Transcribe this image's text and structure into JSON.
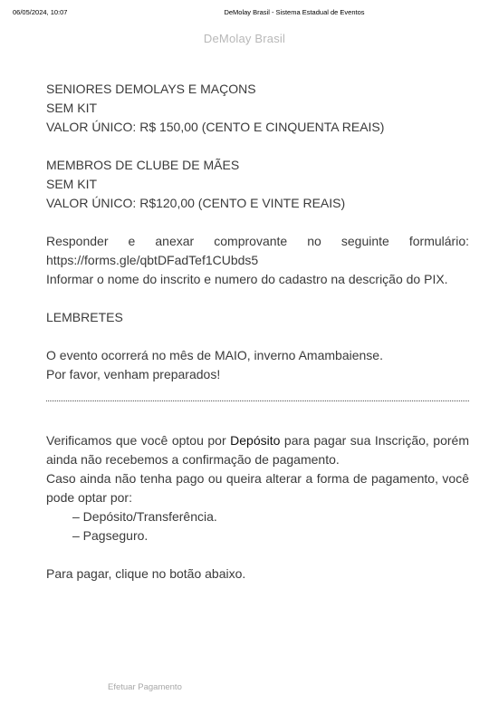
{
  "print_header": {
    "datetime": "06/05/2024, 10:07",
    "title": "DeMolay Brasil - Sistema Estadual de Eventos"
  },
  "site_title": "DeMolay Brasil",
  "pricing": [
    {
      "category": "SENIORES DEMOLAYS E MAÇONS",
      "kit": "SEM KIT",
      "price": "VALOR ÚNICO: R$ 150,00 (CENTO E CINQUENTA REAIS)"
    },
    {
      "category": "MEMBROS DE CLUBE DE MÃES",
      "kit": "SEM KIT",
      "price": "VALOR ÚNICO: R$120,00 (CENTO E VINTE REAIS)"
    }
  ],
  "form_instructions": {
    "line1": "Responder e anexar comprovante no seguinte formulário: https://forms.gle/qbtDFadTef1CUbds5",
    "line2": "Informar o nome do inscrito e numero do cadastro na descrição do PIX."
  },
  "reminders": {
    "heading": "LEMBRETES",
    "line1": "O evento ocorrerá no mês de MAIO, inverno Amambaiense.",
    "line2": "Por favor, venham preparados!"
  },
  "payment_status": {
    "prefix": "Verificamos que você optou por ",
    "method": "Depósito",
    "suffix": " para pagar sua Inscrição, porém ainda não recebemos a confirmação de pagamento."
  },
  "payment_options": {
    "intro": "Caso ainda não tenha pago ou queira alterar a forma de pagamento, você pode optar por:",
    "options": [
      "– Depósito/Transferência.",
      "– Pagseguro."
    ],
    "cta_text": "Para pagar, clique no botão abaixo."
  },
  "pay_button_label": "Efetuar Pagamento"
}
